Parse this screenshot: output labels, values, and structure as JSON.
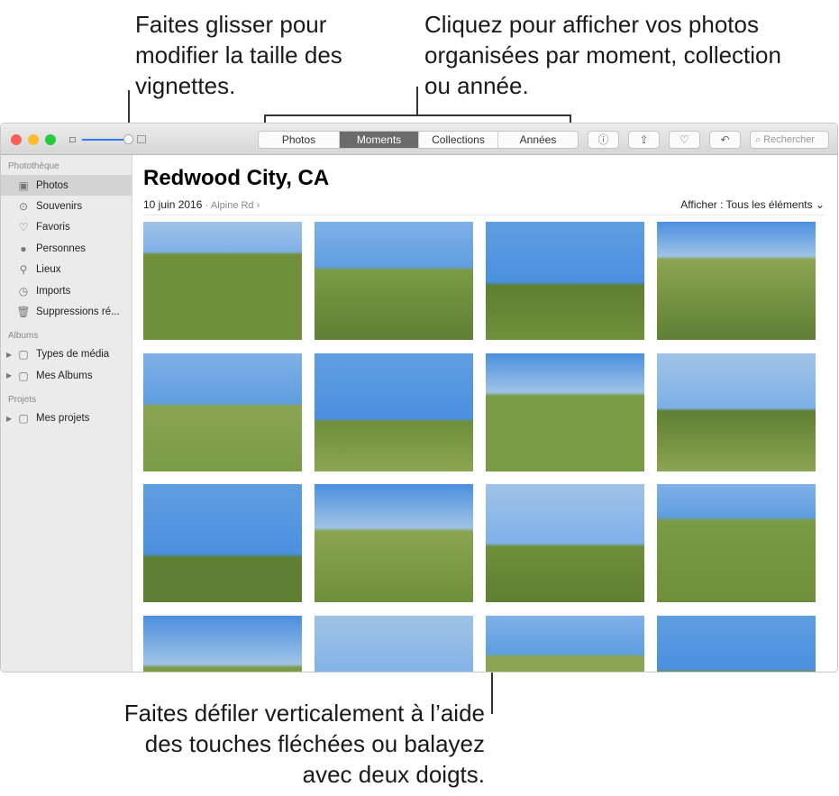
{
  "callouts": {
    "slider": "Faites glisser pour modifier la taille des vignettes.",
    "tabs": "Cliquez pour afficher vos photos organisées par moment, collection ou année.",
    "scroll": "Faites défiler verticalement à l’aide des touches fléchées ou balayez avec deux doigts."
  },
  "toolbar": {
    "tabs": [
      "Photos",
      "Moments",
      "Collections",
      "Années"
    ],
    "active": "Moments",
    "search_placeholder": "Rechercher"
  },
  "sidebar": {
    "library_header": "Photothèque",
    "library": [
      {
        "label": "Photos",
        "icon": "photos-icon"
      },
      {
        "label": "Souvenirs",
        "icon": "memories-icon"
      },
      {
        "label": "Favoris",
        "icon": "heart-icon"
      },
      {
        "label": "Personnes",
        "icon": "person-icon"
      },
      {
        "label": "Lieux",
        "icon": "pin-icon"
      },
      {
        "label": "Imports",
        "icon": "clock-icon"
      },
      {
        "label": "Suppressions ré...",
        "icon": "trash-icon"
      }
    ],
    "albums_header": "Albums",
    "albums": [
      "Types de média",
      "Mes Albums"
    ],
    "projects_header": "Projets",
    "projects": [
      "Mes projets"
    ]
  },
  "main": {
    "title": "Redwood City, CA",
    "date": "10 juin 2016",
    "location": "Alpine Rd",
    "filter_label": "Afficher :",
    "filter_value": "Tous les éléments"
  }
}
